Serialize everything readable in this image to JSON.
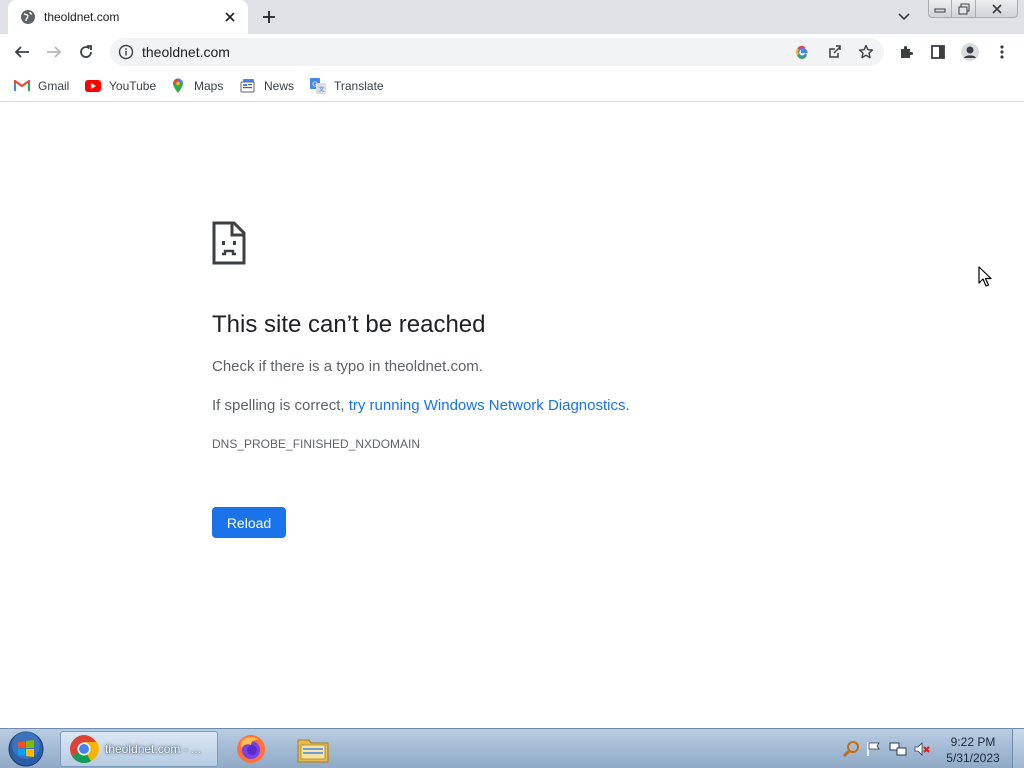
{
  "tab": {
    "title": "theoldnet.com"
  },
  "omnibox": {
    "url": "theoldnet.com"
  },
  "bookmarks": [
    {
      "label": "Gmail",
      "icon": "gmail-icon"
    },
    {
      "label": "YouTube",
      "icon": "youtube-icon"
    },
    {
      "label": "Maps",
      "icon": "maps-icon"
    },
    {
      "label": "News",
      "icon": "news-icon"
    },
    {
      "label": "Translate",
      "icon": "translate-icon"
    }
  ],
  "error": {
    "title": "This site can’t be reached",
    "line1": "Check if there is a typo in theoldnet.com.",
    "line2_prefix": "If spelling is correct, ",
    "line2_link": "try running Windows Network Diagnostics",
    "line2_suffix": ".",
    "code": "DNS_PROBE_FINISHED_NXDOMAIN",
    "reload_label": "Reload"
  },
  "taskbar": {
    "chrome_label": "theoldnet.com - ...",
    "time": "9:22 PM",
    "date": "5/31/2023"
  },
  "colors": {
    "accent": "#1a73e8",
    "tabstrip": "#dee1e6",
    "text_secondary": "#5f6368"
  }
}
